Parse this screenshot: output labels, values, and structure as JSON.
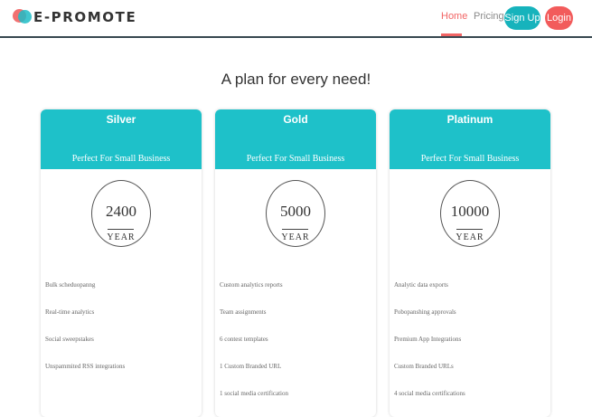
{
  "header": {
    "logo_text": "E-PROMOTE",
    "nav": {
      "home": "Home",
      "pricing": "Pricing"
    },
    "buttons": {
      "signup": "Sign Up",
      "login": "Login"
    }
  },
  "headline": "A plan for every need!",
  "colors": {
    "teal": "#1ec1c9",
    "coral": "#f25b5b",
    "navbar_border": "#37474f"
  },
  "plans": [
    {
      "name": "Silver",
      "subtitle": "Perfect For Small Business",
      "price": "2400",
      "period": "YEAR",
      "features": [
        "Bulk scheduopanng",
        "Real-time analytics",
        "Social sweepstakes",
        "Unspammited RSS integrations"
      ]
    },
    {
      "name": "Gold",
      "subtitle": "Perfect For Small Business",
      "price": "5000",
      "period": "YEAR",
      "features": [
        "Custom analytics reports",
        "Team assignments",
        "6 contest templates",
        "1 Custom Branded URL",
        "1 social media certification"
      ]
    },
    {
      "name": "Platinum",
      "subtitle": "Perfect For Small Business",
      "price": "10000",
      "period": "YEAR",
      "features": [
        "Analytic data exports",
        "Pobopanshing approvals",
        "Premium App Integrations",
        "Custom Branded URLs",
        "4 social media certifications"
      ]
    }
  ]
}
